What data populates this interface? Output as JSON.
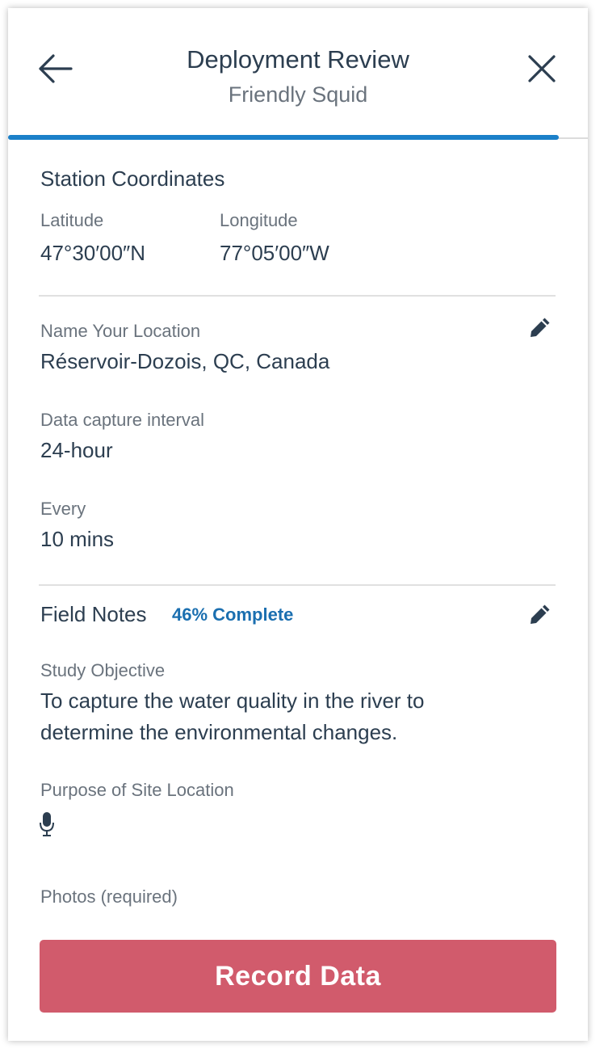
{
  "header": {
    "title": "Deployment Review",
    "subtitle": "Friendly Squid",
    "progress": 0.95
  },
  "coordinates": {
    "section_title": "Station Coordinates",
    "latitude_label": "Latitude",
    "latitude_value": "47°30′00″N",
    "longitude_label": "Longitude",
    "longitude_value": "77°05′00″W"
  },
  "location": {
    "name_label": "Name Your Location",
    "name_value": "Réservoir-Dozois, QC, Canada",
    "interval_label": "Data capture interval",
    "interval_value": "24-hour",
    "every_label": "Every",
    "every_value": "10 mins"
  },
  "field_notes": {
    "section_title": "Field Notes",
    "complete_text": "46% Complete",
    "objective_label": "Study Objective",
    "objective_line1": "To capture the water quality in the river to",
    "objective_line2": "determine the environmental changes.",
    "purpose_label": "Purpose of Site Location",
    "photos_label": "Photos (required)"
  },
  "actions": {
    "record_label": "Record Data"
  },
  "colors": {
    "accent": "#1b80c9",
    "record_button": "#d15b6c",
    "complete_text": "#1b6fb0"
  },
  "icons": [
    "back-arrow-icon",
    "close-icon",
    "pencil-icon",
    "microphone-icon"
  ]
}
